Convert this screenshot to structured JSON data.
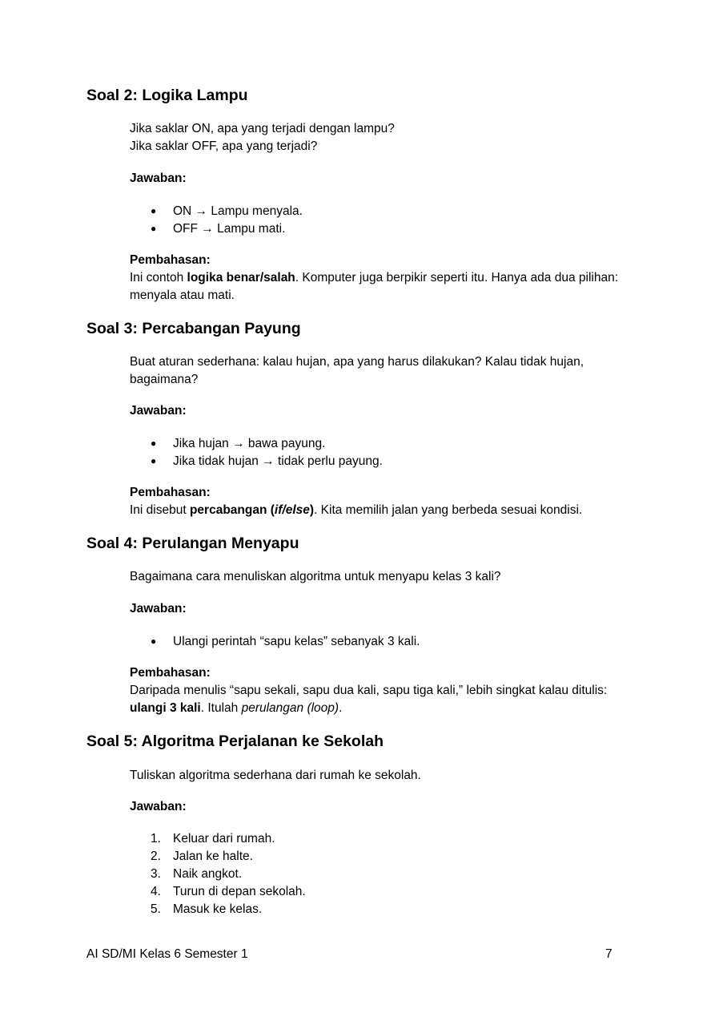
{
  "sections": [
    {
      "title": "Soal 2: Logika Lampu",
      "question_lines": [
        "Jika saklar ON, apa yang terjadi dengan lampu?",
        "Jika saklar OFF, apa yang terjadi?"
      ],
      "answer_label": "Jawaban:",
      "answers": [
        "ON → Lampu menyala.",
        "OFF → Lampu mati."
      ],
      "discussion_label": "Pembahasan:",
      "discussion": {
        "pre": "Ini contoh ",
        "bold": "logika benar/salah",
        "post": ". Komputer juga berpikir seperti itu. Hanya ada dua pilihan: menyala atau mati."
      }
    },
    {
      "title": "Soal 3: Percabangan Payung",
      "question": "Buat aturan sederhana: kalau hujan, apa yang harus dilakukan? Kalau tidak hujan, bagaimana?",
      "answer_label": "Jawaban:",
      "answers": [
        "Jika hujan → bawa payung.",
        "Jika tidak hujan → tidak perlu payung."
      ],
      "discussion_label": "Pembahasan:",
      "discussion": {
        "pre": "Ini disebut ",
        "bold1": "percabangan (",
        "bold_italic": "if/else",
        "bold2": ")",
        "post": ". Kita memilih jalan yang berbeda sesuai kondisi."
      }
    },
    {
      "title": "Soal 4: Perulangan Menyapu",
      "question": "Bagaimana cara menuliskan algoritma untuk menyapu kelas 3 kali?",
      "answer_label": "Jawaban:",
      "answers": [
        "Ulangi perintah “sapu kelas” sebanyak 3 kali."
      ],
      "discussion_label": "Pembahasan:",
      "discussion": {
        "pre": "Daripada menulis “sapu sekali, sapu dua kali, sapu tiga kali,” lebih singkat kalau ditulis: ",
        "bold": "ulangi 3 kali",
        "mid": ". Itulah ",
        "italic": "perulangan (loop)",
        "post": "."
      }
    },
    {
      "title": "Soal 5: Algoritma Perjalanan ke Sekolah",
      "question": "Tuliskan algoritma sederhana dari rumah ke sekolah.",
      "answer_label": "Jawaban:",
      "steps": [
        {
          "num": "1.",
          "text": "Keluar dari rumah."
        },
        {
          "num": "2.",
          "text": "Jalan ke halte."
        },
        {
          "num": "3.",
          "text": "Naik angkot."
        },
        {
          "num": "4.",
          "text": "Turun di depan sekolah."
        },
        {
          "num": "5.",
          "text": "Masuk ke kelas."
        }
      ]
    }
  ],
  "bullet": "●",
  "footer": {
    "left": "AI SD/MI Kelas 6 Semester 1",
    "page_number": "7"
  }
}
